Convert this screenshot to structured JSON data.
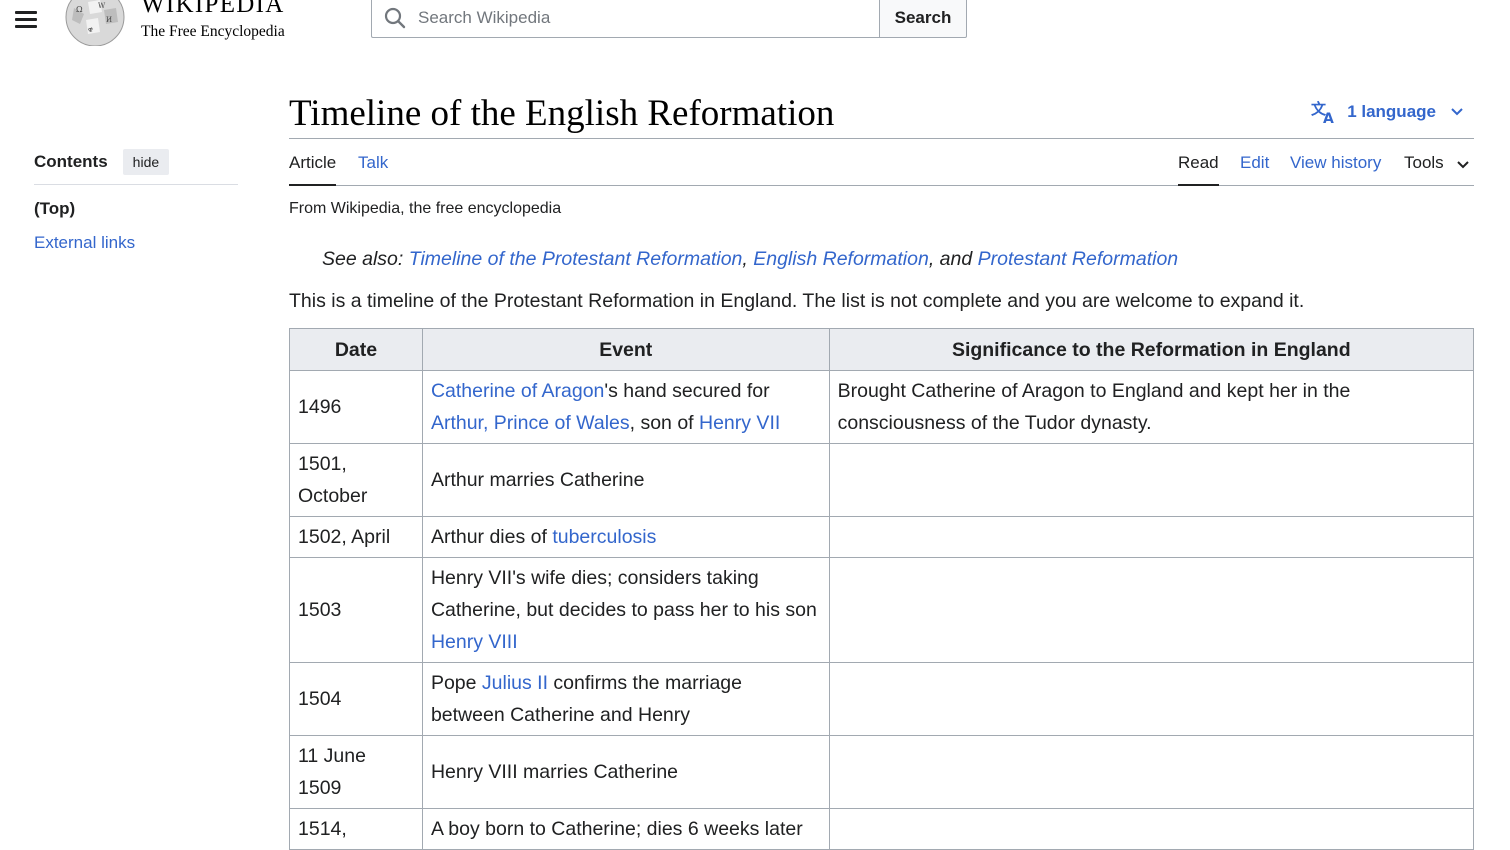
{
  "header": {
    "logo_name": "Wikipedia",
    "wordmark_name": "WIKIPEDIA",
    "tagline": "The Free Encyclopedia",
    "search_placeholder": "Search Wikipedia",
    "search_button": "Search",
    "menu_icon": "hamburger-icon"
  },
  "toc": {
    "title": "Contents",
    "hide_label": "hide",
    "items": [
      {
        "label": "(Top)"
      },
      {
        "label": "External links"
      }
    ]
  },
  "page": {
    "title": "Timeline of the English Reformation",
    "language_label": "1 language",
    "tabs": {
      "article": "Article",
      "talk": "Talk",
      "read": "Read",
      "edit": "Edit",
      "history": "View history",
      "tools": "Tools"
    },
    "subtitle": "From Wikipedia, the free encyclopedia",
    "see_also": {
      "prefix": "See also: ",
      "links": [
        "Timeline of the Protestant Reformation",
        "English Reformation",
        "Protestant Reformation"
      ],
      "sep1": ", ",
      "sep2": ", and "
    },
    "intro": "This is a timeline of the Protestant Reformation in England. The list is not complete and you are welcome to expand it."
  },
  "table": {
    "headers": [
      "Date",
      "Event",
      "Significance to the Reformation in England"
    ],
    "rows": [
      {
        "date": "1496",
        "event": [
          {
            "text": "Catherine of Aragon",
            "link": true
          },
          {
            "text": "'s hand secured for ",
            "link": false
          },
          {
            "text": "Arthur, Prince of Wales",
            "link": true
          },
          {
            "text": ", son of ",
            "link": false
          },
          {
            "text": "Henry VII",
            "link": true
          }
        ],
        "significance": "Brought Catherine of Aragon to England and kept her in the consciousness of the Tudor dynasty."
      },
      {
        "date": "1501, October",
        "event": [
          {
            "text": "Arthur marries Catherine",
            "link": false
          }
        ],
        "significance": ""
      },
      {
        "date": "1502, April",
        "event": [
          {
            "text": "Arthur dies of ",
            "link": false
          },
          {
            "text": "tuberculosis",
            "link": true
          }
        ],
        "significance": ""
      },
      {
        "date": "1503",
        "event": [
          {
            "text": "Henry VII's wife dies; considers taking Catherine, but decides to pass her to his son ",
            "link": false
          },
          {
            "text": "Henry VIII",
            "link": true
          }
        ],
        "significance": ""
      },
      {
        "date": "1504",
        "event": [
          {
            "text": "Pope ",
            "link": false
          },
          {
            "text": "Julius II",
            "link": true
          },
          {
            "text": " confirms the marriage between Catherine and Henry",
            "link": false
          }
        ],
        "significance": ""
      },
      {
        "date": "11 June 1509",
        "event": [
          {
            "text": "Henry VIII marries Catherine",
            "link": false
          }
        ],
        "significance": ""
      },
      {
        "date": "1514, ",
        "event": [
          {
            "text": "A boy born to Catherine; dies 6 weeks later",
            "link": false
          }
        ],
        "significance": ""
      }
    ]
  },
  "colors": {
    "link": "#3366cc",
    "border": "#a2a9b1",
    "header_bg": "#eaecf0"
  }
}
